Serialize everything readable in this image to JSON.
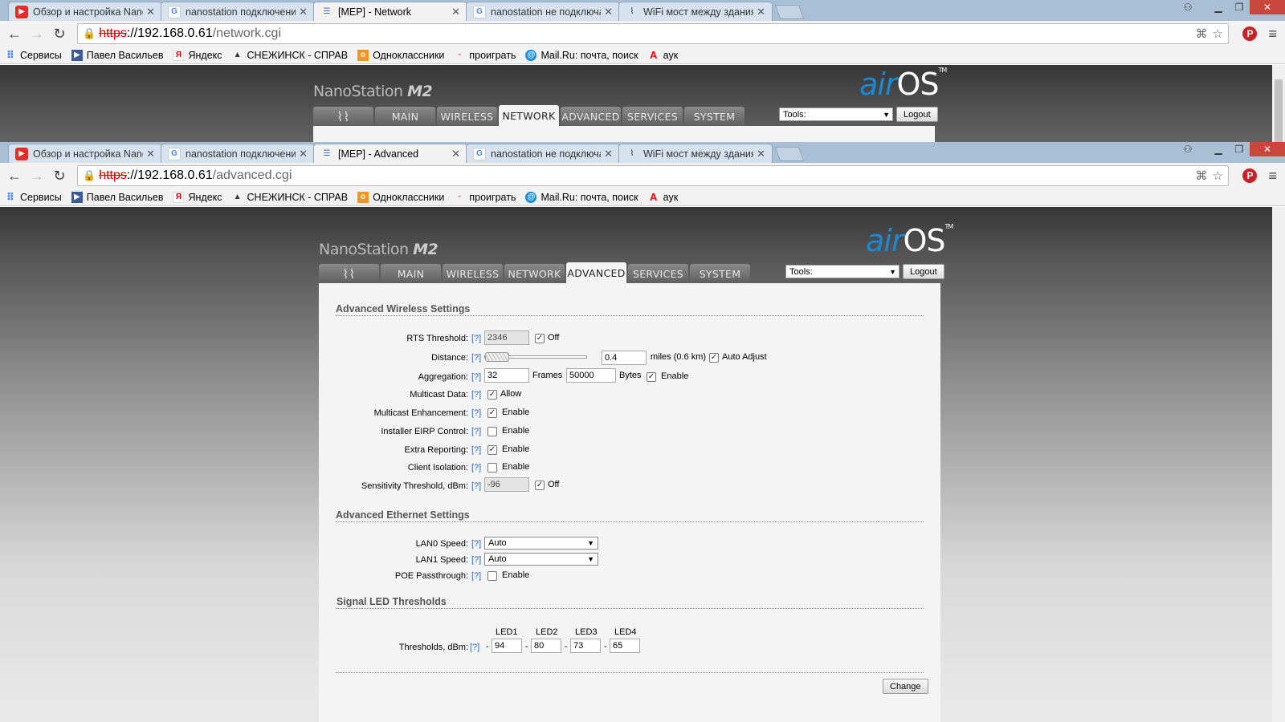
{
  "windows": [
    {
      "tabs": [
        {
          "icon": "youtube-icon",
          "label": "Обзор и настройка Nano"
        },
        {
          "icon": "google-icon",
          "label": "nanostation подключени"
        },
        {
          "icon": "rss-icon",
          "label": "[MEP] - Network",
          "active": true
        },
        {
          "icon": "google-icon",
          "label": "nanostation не подключа"
        },
        {
          "icon": "wifi-icon",
          "label": "WiFi мост между здания"
        }
      ],
      "url": {
        "scheme": "https",
        "rest": "://",
        "host": "192.168.0.61",
        "path": "/network.cgi"
      }
    },
    {
      "tabs": [
        {
          "icon": "youtube-icon",
          "label": "Обзор и настройка Nano"
        },
        {
          "icon": "google-icon",
          "label": "nanostation подключени"
        },
        {
          "icon": "rss-icon",
          "label": "[MEP] - Advanced",
          "active": true
        },
        {
          "icon": "google-icon",
          "label": "nanostation не подключа"
        },
        {
          "icon": "wifi-icon",
          "label": "WiFi мост между здания"
        }
      ],
      "url": {
        "scheme": "https",
        "rest": "://",
        "host": "192.168.0.61",
        "path": "/advanced.cgi"
      }
    }
  ],
  "bookmarks": [
    {
      "icon": "apps-icon",
      "label": "Сервисы"
    },
    {
      "icon": "bookmark-icon",
      "label": "Павел Васильев"
    },
    {
      "icon": "yandex-icon",
      "label": "Яндекс"
    },
    {
      "icon": "snezhinsk-icon",
      "label": "СНЕЖИНСК - СПРАВ"
    },
    {
      "icon": "odnoklassniki-icon",
      "label": "Одноклассники"
    },
    {
      "icon": "bookmark-icon",
      "label": "проиграть"
    },
    {
      "icon": "mailru-icon",
      "label": "Mail.Ru: почта, поиск"
    },
    {
      "icon": "letter-a-icon",
      "label": "аук"
    }
  ],
  "device": {
    "model": "NanoStation",
    "model_suffix": "M2",
    "os_air": "air",
    "os_os": "OS",
    "trademark": "TM"
  },
  "nav_tabs": [
    "MAIN",
    "WIRELESS",
    "NETWORK",
    "ADVANCED",
    "SERVICES",
    "SYSTEM"
  ],
  "tools": {
    "label": "Tools:",
    "logout": "Logout"
  },
  "help": "[?]",
  "wireless": {
    "title": "Advanced Wireless Settings",
    "rts": {
      "label": "RTS Threshold:",
      "value": "2346",
      "off": "Off",
      "off_checked": true
    },
    "distance": {
      "label": "Distance:",
      "value": "0.4",
      "unit": "miles (0.6 km)",
      "auto_label": "Auto Adjust",
      "auto_checked": true,
      "slider_fraction": 0.0
    },
    "aggregation": {
      "label": "Aggregation:",
      "frames": "32",
      "frames_unit": "Frames",
      "bytes": "50000",
      "bytes_unit": "Bytes",
      "enable": "Enable",
      "enabled": true
    },
    "multicast_data": {
      "label": "Multicast Data:",
      "option": "Allow",
      "checked": true
    },
    "multicast_enh": {
      "label": "Multicast Enhancement:",
      "option": "Enable",
      "checked": true
    },
    "eirp": {
      "label": "Installer EIRP Control:",
      "option": "Enable",
      "checked": false
    },
    "extra": {
      "label": "Extra Reporting:",
      "option": "Enable",
      "checked": true
    },
    "isolation": {
      "label": "Client Isolation:",
      "option": "Enable",
      "checked": false
    },
    "sensitivity": {
      "label": "Sensitivity Threshold, dBm:",
      "value": "-96",
      "off": "Off",
      "off_checked": true
    }
  },
  "ethernet": {
    "title": "Advanced Ethernet Settings",
    "lan0": {
      "label": "LAN0 Speed:",
      "value": "Auto"
    },
    "lan1": {
      "label": "LAN1 Speed:",
      "value": "Auto"
    },
    "poe": {
      "label": "POE Passthrough:",
      "option": "Enable",
      "checked": false
    }
  },
  "led": {
    "title": "Signal LED Thresholds",
    "headers": [
      "LED1",
      "LED2",
      "LED3",
      "LED4"
    ],
    "label": "Thresholds, dBm:",
    "dash": "-",
    "values": [
      "94",
      "80",
      "73",
      "65"
    ]
  },
  "change_button": "Change"
}
